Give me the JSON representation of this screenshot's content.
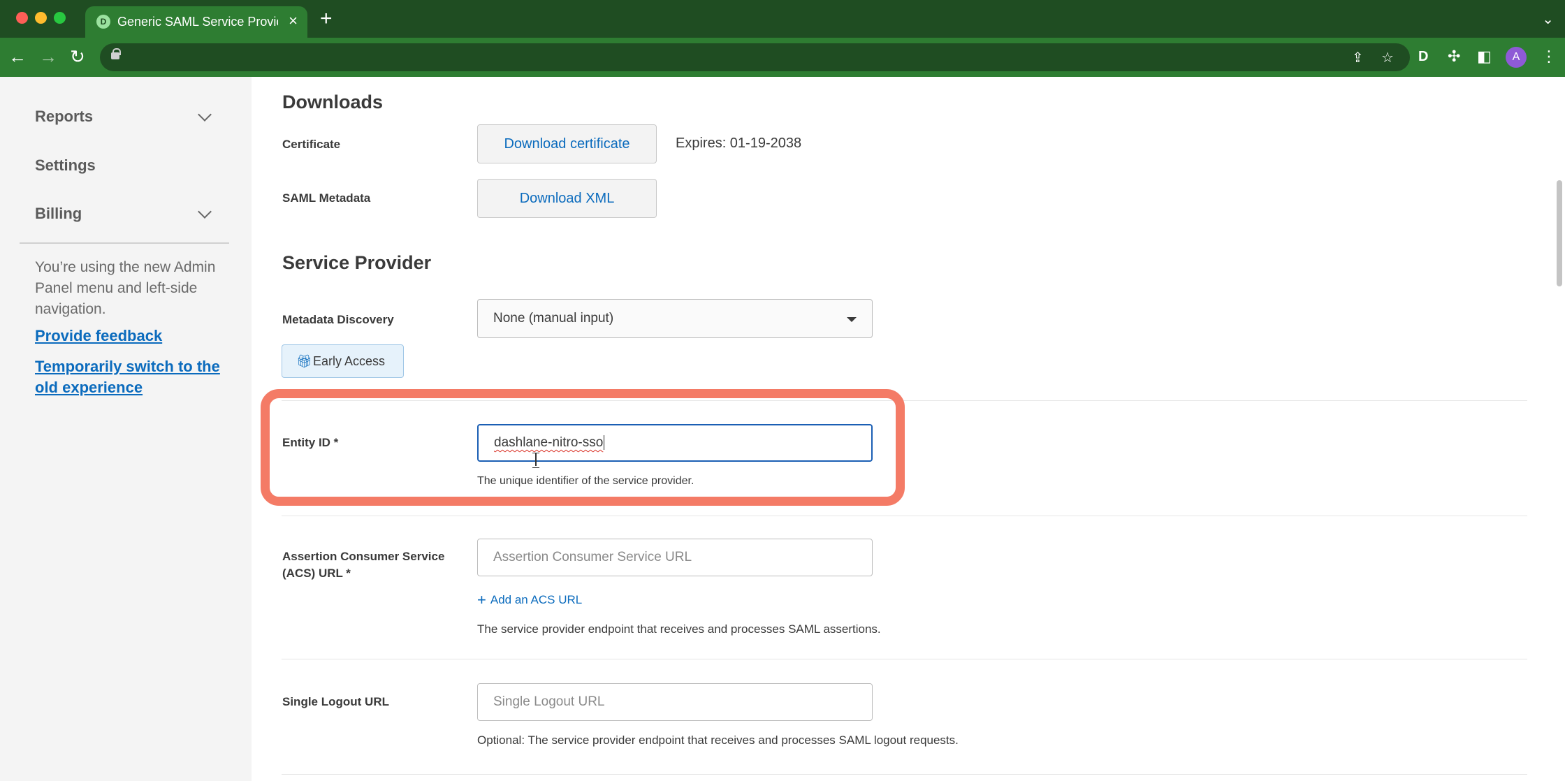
{
  "browser": {
    "tab_title": "Generic SAML Service Provider",
    "favicon_text": "D",
    "avatar_initial": "A"
  },
  "sidebar": {
    "items": [
      {
        "label": "Reports",
        "expandable": true
      },
      {
        "label": "Settings",
        "expandable": false
      },
      {
        "label": "Billing",
        "expandable": true
      }
    ],
    "note": "You’re using the new Admin Panel menu and left-side navigation.",
    "feedback_link": "Provide feedback",
    "switch_link": "Temporarily switch to the old experience"
  },
  "downloads": {
    "heading": "Downloads",
    "certificate_label": "Certificate",
    "certificate_button": "Download certificate",
    "certificate_expiry": "Expires: 01-19-2038",
    "metadata_label": "SAML Metadata",
    "metadata_button": "Download XML"
  },
  "service_provider": {
    "heading": "Service Provider",
    "discovery_label": "Metadata Discovery",
    "discovery_value": "None (manual input)",
    "early_access_label": "Early Access",
    "entity_id_label": "Entity ID *",
    "entity_id_value": "dashlane-nitro-sso",
    "entity_id_help": "The unique identifier of the service provider.",
    "acs_label": "Assertion Consumer Service (ACS) URL *",
    "acs_placeholder": "Assertion Consumer Service URL",
    "acs_add_link": "Add an ACS URL",
    "acs_help": "The service provider endpoint that receives and processes SAML assertions.",
    "slo_label": "Single Logout URL",
    "slo_placeholder": "Single Logout URL",
    "slo_help": "Optional: The service provider endpoint that receives and processes SAML logout requests."
  },
  "colors": {
    "accent": "#0b6bbd",
    "highlight": "#f47b66",
    "browser_frame": "#2e7d32"
  }
}
